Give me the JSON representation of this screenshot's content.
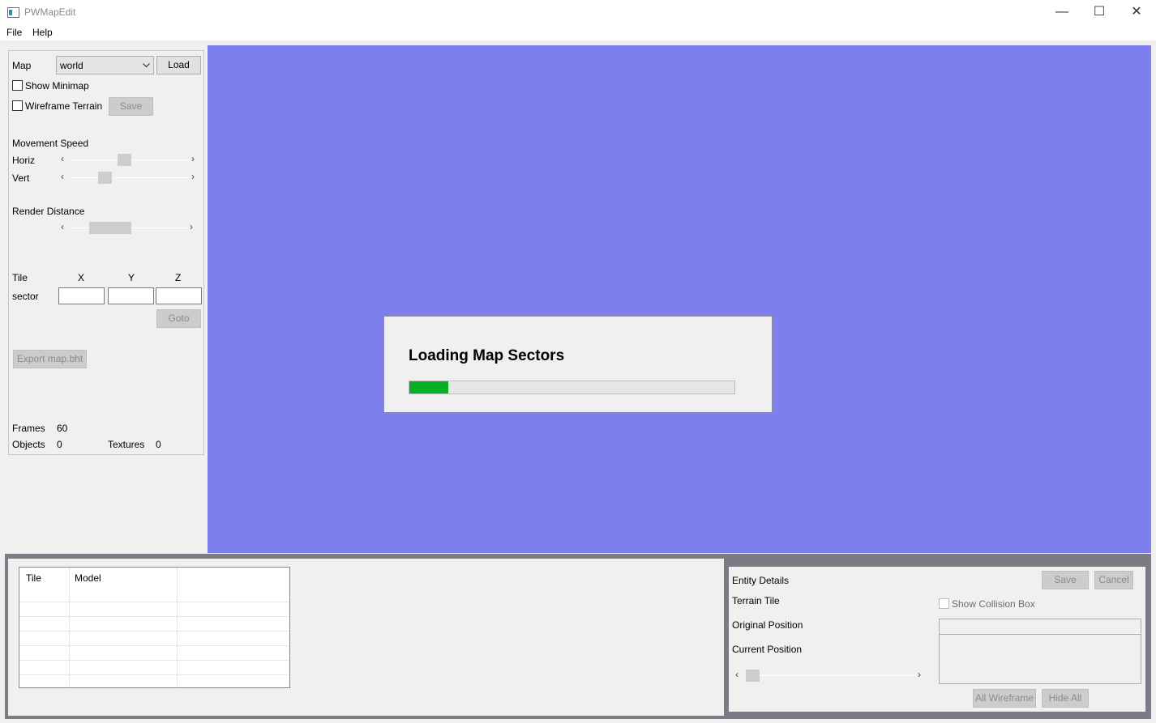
{
  "window": {
    "title": "PWMapEdit",
    "minimize_glyph": "—",
    "maximize_glyph": "☐",
    "close_glyph": "✕"
  },
  "menu": {
    "items": [
      "File",
      "Help"
    ]
  },
  "left_panel": {
    "map_label": "Map",
    "map_selected": "world",
    "load_button": "Load",
    "show_minimap_label": "Show Minimap",
    "wireframe_terrain_label": "Wireframe Terrain",
    "save_button": "Save",
    "movement_speed_label": "Movement Speed",
    "horiz_label": "Horiz",
    "vert_label": "Vert",
    "render_distance_label": "Render Distance",
    "tile_label": "Tile",
    "x_label": "X",
    "y_label": "Y",
    "z_label": "Z",
    "sector_label": "sector",
    "goto_button": "Goto",
    "export_button": "Export map.bht",
    "frames_label": "Frames",
    "frames_value": "60",
    "objects_label": "Objects",
    "objects_value": "0",
    "textures_label": "Textures",
    "textures_value": "0",
    "horiz_speed": 0.45,
    "vert_speed": 0.27,
    "render_distance": 0.25
  },
  "loading": {
    "title": "Loading Map Sectors",
    "progress": 0.12,
    "fill_color": "#06b025"
  },
  "viewport": {
    "background": "#7e7fef"
  },
  "table": {
    "columns": [
      "Tile",
      "Model",
      ""
    ]
  },
  "entity": {
    "details_label": "Entity Details",
    "save_button": "Save",
    "cancel_button": "Cancel",
    "terrain_tile_label": "Terrain Tile",
    "show_collision_box_label": "Show Collision Box",
    "original_position_label": "Original Position",
    "current_position_label": "Current Position",
    "all_wireframe_button": "All Wireframe",
    "hide_all_button": "Hide All"
  }
}
